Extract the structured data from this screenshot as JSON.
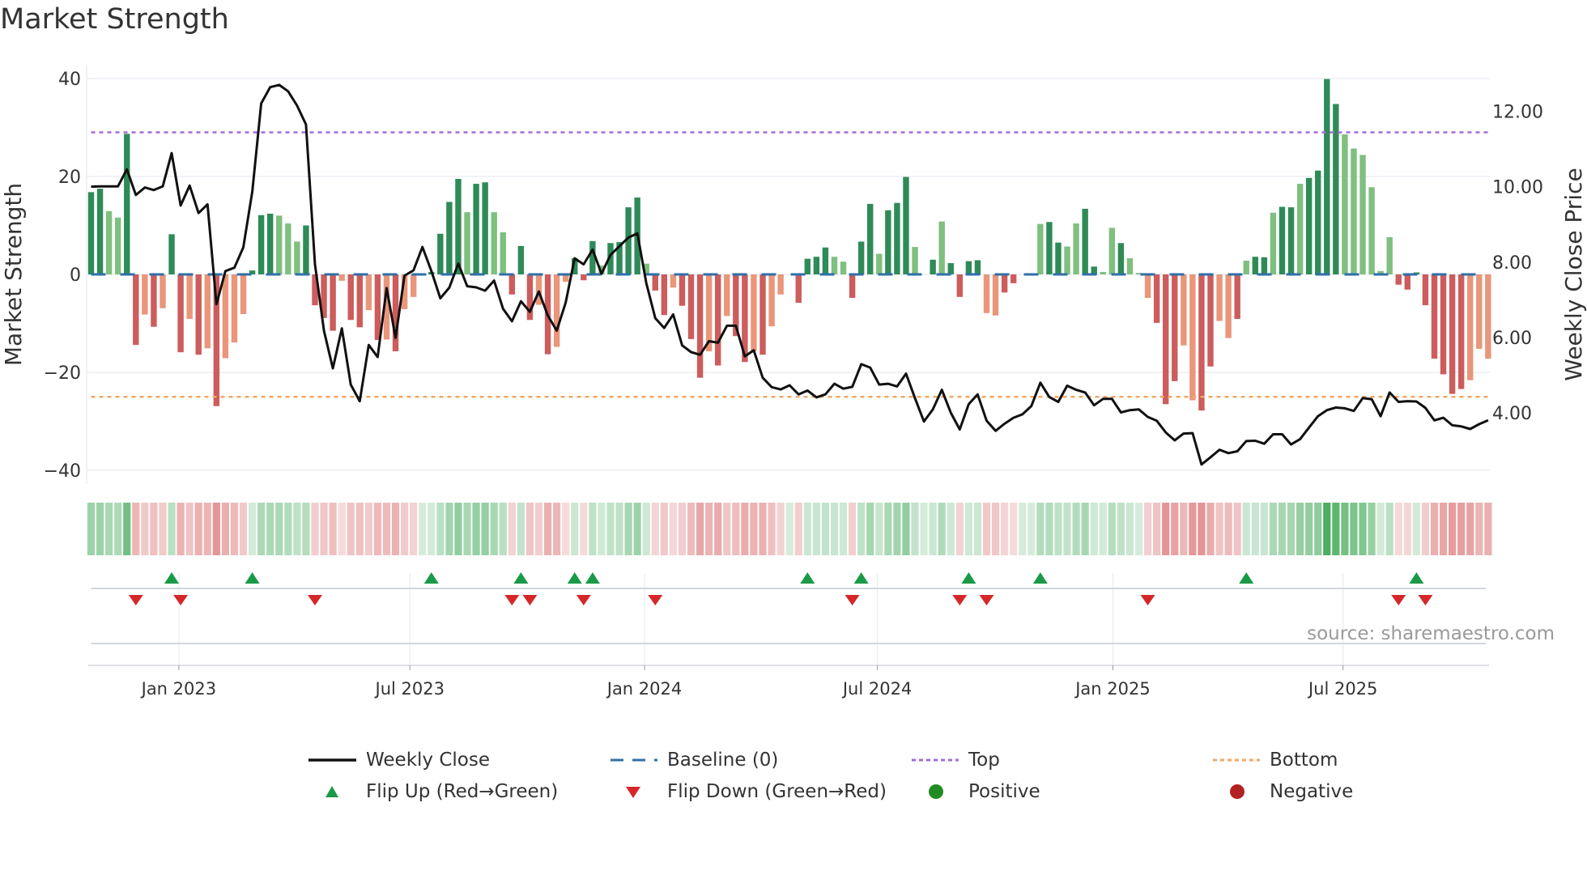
{
  "title": "Market Strength",
  "source": "source: sharemaestro.com",
  "colors": {
    "pos_strong": "#2e8b57",
    "pos_weak": "#7fbf7f",
    "neg_strong": "#cd5c5c",
    "neg_weak": "#e9967a",
    "baseline": "#2f6fa8",
    "top": "#a66bd9",
    "bottom": "#f2a865",
    "close": "#111111",
    "flip_up": "#1a9a48",
    "flip_down": "#d62728",
    "positive": "#228b22",
    "negative": "#b22222"
  },
  "legend": {
    "close": "Weekly Close",
    "baseline": "Baseline (0)",
    "top": "Top",
    "bottom": "Bottom",
    "flip_up": "Flip Up (Red→Green)",
    "flip_down": "Flip Down (Green→Red)",
    "positive": "Positive",
    "negative": "Negative"
  },
  "chart_data": {
    "type": "bar",
    "title": "Market Strength",
    "xlabel": "",
    "ylabel": "Market Strength",
    "y2label": "Weekly Close Price",
    "ylim": [
      -43,
      40.5
    ],
    "y2lim": [
      2.3,
      13.2
    ],
    "yticks": [
      "40",
      "20",
      "0",
      "−20",
      "−40"
    ],
    "ytick_values": [
      40,
      20,
      0,
      -20,
      -40
    ],
    "y2ticks": [
      "12.00",
      "10.00",
      "8.00",
      "6.00",
      "4.00"
    ],
    "y2tick_values": [
      12,
      10,
      8,
      6,
      4
    ],
    "xticks": [
      {
        "label": "Jan 2023",
        "week": 9.8
      },
      {
        "label": "Jul 2023",
        "week": 35.6
      },
      {
        "label": "Jan 2024",
        "week": 61.8
      },
      {
        "label": "Jul 2024",
        "week": 87.8
      },
      {
        "label": "Jan 2025",
        "week": 114.1
      },
      {
        "label": "Jul 2025",
        "week": 139.8
      }
    ],
    "top_level": 29,
    "bottom_level": -25,
    "baseline": 0,
    "strength": [
      16.8,
      17.5,
      12.9,
      11.6,
      28.7,
      -14.4,
      -8.2,
      -10.7,
      -6.9,
      8.2,
      -15.9,
      -9.1,
      -16.4,
      -15.1,
      -26.9,
      -17.1,
      -13.9,
      -8.1,
      0.8,
      12.1,
      12.4,
      12.0,
      10.4,
      6.7,
      10.0,
      -6.3,
      -8.9,
      -11.5,
      -1.3,
      -9.3,
      -10.8,
      -7.3,
      -13.4,
      -13.3,
      -15.7,
      -7.1,
      -4.6,
      0,
      0.5,
      8.3,
      14.8,
      19.5,
      12.7,
      18.5,
      18.8,
      12.7,
      8.6,
      -4.1,
      5.8,
      -9.3,
      -6.2,
      -16.3,
      -14.8,
      -1.5,
      3.3,
      -1.2,
      6.8,
      1.8,
      6.4,
      6.6,
      13.7,
      15.7,
      2.2,
      -3.3,
      -8.3,
      -2.7,
      -6.4,
      -13.2,
      -21.1,
      -15.7,
      -18.6,
      -8.5,
      -12.6,
      -17.9,
      -15.7,
      -16.4,
      -10.6,
      -4.1,
      0,
      -5.8,
      3.2,
      3.6,
      5.5,
      3.6,
      2.6,
      -4.8,
      6.7,
      14.4,
      4.2,
      13.1,
      14.6,
      19.9,
      5.6,
      0,
      3.0,
      10.8,
      2.3,
      -4.6,
      2.7,
      2.9,
      -7.9,
      -8.4,
      -3.7,
      -1.8,
      0,
      0,
      10.3,
      10.7,
      6.5,
      5.7,
      10.4,
      13.4,
      1.6,
      0.5,
      9.5,
      6.4,
      3.3,
      0.3,
      -4.8,
      -9.9,
      -26.5,
      -21.8,
      -14.5,
      -25.7,
      -27.8,
      -18.8,
      -9.5,
      -13.0,
      -9.1,
      2.8,
      3.6,
      3.5,
      12.6,
      13.8,
      13.7,
      18.5,
      19.7,
      21.2,
      39.9,
      34.8,
      28.6,
      25.7,
      24.4,
      17.8,
      0.7,
      7.6,
      -2.1,
      -3.1,
      0.4,
      -6.3,
      -17.2,
      -20.4,
      -24.4,
      -23.4,
      -21.6,
      -15.2,
      -17.2
    ],
    "shade": "DDLLDDLDLDDLDLDLLLDDDLLLDDDDLDDLDLDLLDDDDDLDDLLDDDLDLLDDDLDDDDLDDLDDDLDLDDLDLLDDDDDLLDDDLDDDLDDLDDDDLLDDDLLDDLLDDLLDLLLDDDLLDDLLDLDDLDDLDDDDLLLLLLDDDDDDDDLLLD",
    "weekly_close": [
      10.0,
      10.01,
      10.01,
      10.01,
      10.46,
      9.78,
      9.98,
      9.91,
      10.01,
      10.89,
      9.5,
      10.03,
      9.3,
      9.53,
      6.88,
      7.76,
      7.85,
      8.39,
      9.87,
      12.21,
      12.64,
      12.7,
      12.53,
      12.15,
      11.65,
      7.94,
      6.18,
      5.18,
      6.24,
      4.75,
      4.31,
      5.8,
      5.48,
      7.31,
      5.99,
      7.64,
      7.78,
      8.4,
      7.76,
      7.04,
      7.32,
      7.96,
      7.36,
      7.33,
      7.24,
      7.51,
      6.76,
      6.43,
      6.96,
      6.68,
      7.22,
      6.58,
      6.18,
      6.93,
      8.1,
      7.94,
      8.33,
      7.69,
      8.19,
      8.42,
      8.65,
      8.76,
      7.44,
      6.51,
      6.25,
      6.61,
      5.79,
      5.61,
      5.54,
      5.9,
      5.86,
      6.31,
      6.31,
      5.5,
      5.66,
      4.93,
      4.68,
      4.62,
      4.73,
      4.49,
      4.59,
      4.41,
      4.49,
      4.77,
      4.64,
      4.69,
      5.29,
      5.2,
      4.75,
      4.77,
      4.7,
      5.04,
      4.39,
      3.77,
      4.09,
      4.61,
      4.0,
      3.56,
      4.23,
      4.49,
      3.79,
      3.52,
      3.71,
      3.87,
      3.96,
      4.18,
      4.8,
      4.42,
      4.29,
      4.72,
      4.61,
      4.54,
      4.2,
      4.37,
      4.37,
      4.01,
      4.07,
      4.09,
      3.89,
      3.79,
      3.48,
      3.27,
      3.45,
      3.46,
      2.63,
      2.82,
      3.02,
      2.93,
      2.98,
      3.25,
      3.26,
      3.18,
      3.43,
      3.43,
      3.16,
      3.3,
      3.61,
      3.91,
      4.07,
      4.14,
      4.12,
      4.05,
      4.39,
      4.36,
      3.91,
      4.54,
      4.29,
      4.31,
      4.3,
      4.13,
      3.8,
      3.87,
      3.67,
      3.64,
      3.57,
      3.7,
      3.8
    ],
    "flip_up_weeks": [
      9,
      18,
      38,
      48,
      54,
      56,
      80,
      86,
      98,
      106,
      129,
      148
    ],
    "flip_down_weeks": [
      5,
      10,
      25,
      47,
      49,
      55,
      63,
      85,
      97,
      100,
      118,
      146,
      149
    ],
    "legend_position": "bottom"
  }
}
